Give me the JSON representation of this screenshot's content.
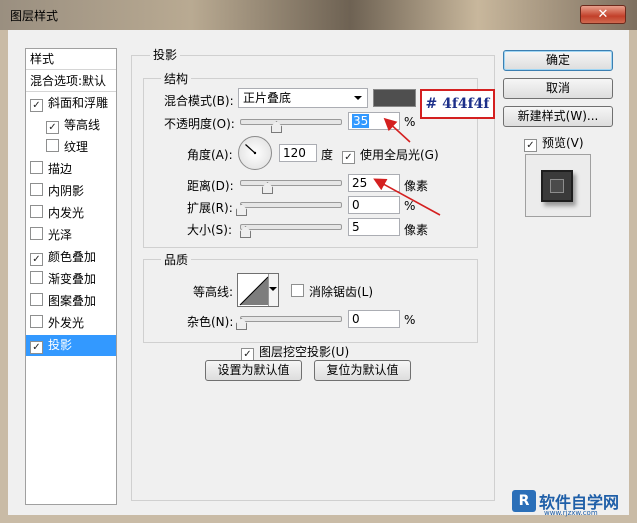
{
  "window": {
    "title": "图层样式",
    "close_glyph": "✕"
  },
  "style_list": {
    "header": "样式",
    "blend_options": "混合选项:默认",
    "items": [
      {
        "label": "斜面和浮雕",
        "checked": true
      },
      {
        "label": "等高线",
        "checked": true
      },
      {
        "label": "纹理",
        "checked": false
      },
      {
        "label": "描边",
        "checked": false
      },
      {
        "label": "内阴影",
        "checked": false
      },
      {
        "label": "内发光",
        "checked": false
      },
      {
        "label": "光泽",
        "checked": false
      },
      {
        "label": "颜色叠加",
        "checked": true
      },
      {
        "label": "渐变叠加",
        "checked": false
      },
      {
        "label": "图案叠加",
        "checked": false
      },
      {
        "label": "外发光",
        "checked": false
      },
      {
        "label": "投影",
        "checked": true
      }
    ],
    "selected": "投影"
  },
  "panel": {
    "title": "投影",
    "structure": {
      "title": "结构",
      "blend_mode_label": "混合模式(B):",
      "blend_mode_value": "正片叠底",
      "shadow_color": "#4f4f4f",
      "opacity_label": "不透明度(O):",
      "opacity_value": "35",
      "opacity_unit": "%",
      "angle_label": "角度(A):",
      "angle_value": "120",
      "angle_unit": "度",
      "global_light_label": "使用全局光(G)",
      "global_light_checked": true,
      "distance_label": "距离(D):",
      "distance_value": "25",
      "distance_unit": "像素",
      "spread_label": "扩展(R):",
      "spread_value": "0",
      "spread_unit": "%",
      "size_label": "大小(S):",
      "size_value": "5",
      "size_unit": "像素"
    },
    "quality": {
      "title": "品质",
      "contour_label": "等高线:",
      "anti_alias_label": "消除锯齿(L)",
      "anti_alias_checked": false,
      "noise_label": "杂色(N):",
      "noise_value": "0",
      "noise_unit": "%"
    },
    "knockout_label": "图层挖空投影(U)",
    "knockout_checked": true,
    "make_default": "设置为默认值",
    "reset_default": "复位为默认值"
  },
  "buttons": {
    "ok": "确定",
    "cancel": "取消",
    "new_style": "新建样式(W)...",
    "preview_label": "预览(V)",
    "preview_checked": true
  },
  "annotation": {
    "text": "# 4f4f4f",
    "color": "#d42020"
  },
  "watermark": {
    "text": "软件自学网",
    "url_text": "www.rjzxw.com"
  }
}
